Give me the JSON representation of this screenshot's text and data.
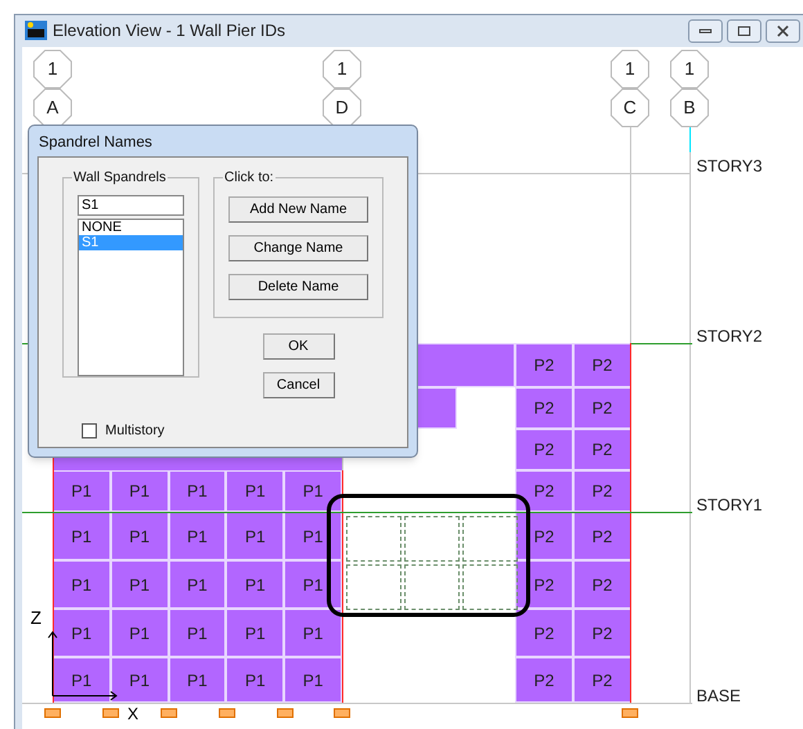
{
  "window": {
    "title": "Elevation View - 1  Wall Pier IDs"
  },
  "grid_lines": [
    {
      "number": "1",
      "letter": "A"
    },
    {
      "number": "1",
      "letter": "D"
    },
    {
      "number": "1",
      "letter": "C"
    },
    {
      "number": "1",
      "letter": "B"
    }
  ],
  "story_levels": [
    {
      "label": "STORY3"
    },
    {
      "label": "STORY2"
    },
    {
      "label": "STORY1"
    },
    {
      "label": "BASE"
    }
  ],
  "left_wall": {
    "rows": [
      [
        "P1",
        "P1",
        "P1",
        "P1",
        "P1"
      ],
      [
        "P1",
        "P1",
        "P1",
        "P1",
        "P1"
      ],
      [
        "P1",
        "P1",
        "P1",
        "P1",
        "P1"
      ],
      [
        "P1",
        "P1",
        "P1",
        "P1",
        "P1"
      ],
      [
        "P1",
        "P1",
        "P1",
        "P1",
        "P1"
      ]
    ]
  },
  "right_wall": {
    "rows": [
      [
        "P2",
        "P2"
      ],
      [
        "P2",
        "P2"
      ],
      [
        "P2",
        "P2"
      ],
      [
        "P2",
        "P2"
      ],
      [
        "P2",
        "P2"
      ],
      [
        "P2",
        "P2"
      ],
      [
        "P2",
        "P2"
      ],
      [
        "P2",
        "P2"
      ]
    ]
  },
  "axes": {
    "vertical": "Z",
    "horizontal": "X"
  },
  "dialog": {
    "title": "Spandrel Names",
    "list_group": "Wall Spandrels",
    "name_value": "S1",
    "names": [
      {
        "label": "NONE",
        "selected": false
      },
      {
        "label": "S1",
        "selected": true
      }
    ],
    "actions_group": "Click to:",
    "actions": [
      "Add New Name",
      "Change Name",
      "Delete Name"
    ],
    "ok": "OK",
    "cancel": "Cancel",
    "multistory": {
      "label": "Multistory",
      "checked": false
    }
  }
}
